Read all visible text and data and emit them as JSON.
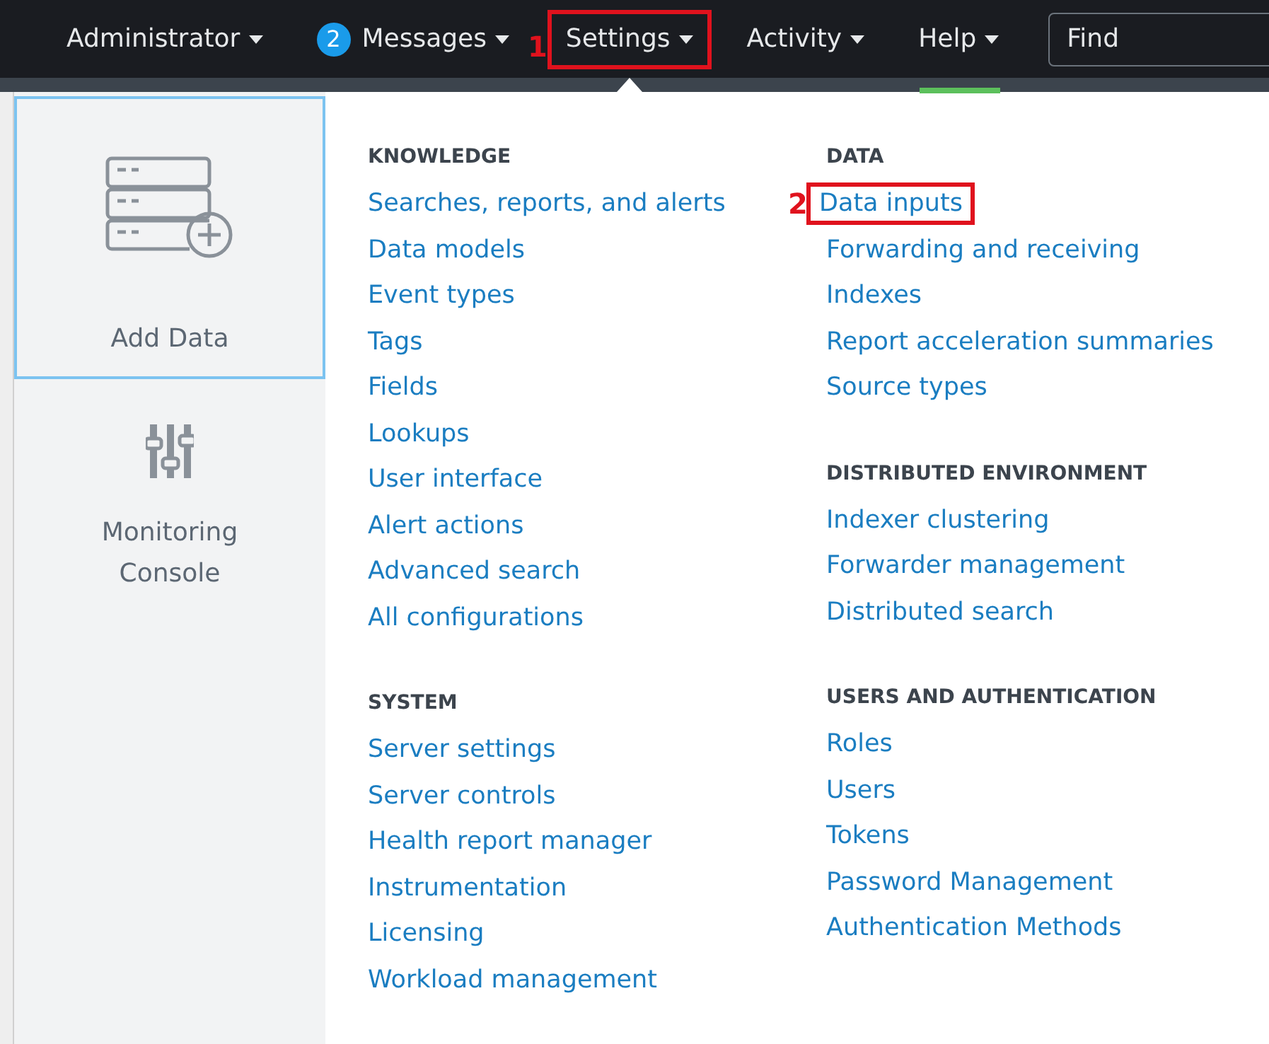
{
  "nav": [
    {
      "label": "Administrator",
      "highlighted": false,
      "open": false,
      "active": false
    },
    {
      "label": "Messages",
      "badge": "2",
      "highlighted": false,
      "open": false,
      "active": false
    },
    {
      "label": "Settings",
      "highlighted": true,
      "annotation": "1",
      "open": true,
      "active": false
    },
    {
      "label": "Activity",
      "highlighted": false,
      "open": false,
      "active": false
    },
    {
      "label": "Help",
      "highlighted": false,
      "open": false,
      "active": true
    }
  ],
  "search": {
    "placeholder": "Find"
  },
  "shortcuts": [
    {
      "label": "Add Data",
      "kind": "add-data",
      "selected": true
    },
    {
      "label": "Monitoring Console",
      "kind": "monitoring",
      "selected": false
    }
  ],
  "columns": [
    [
      {
        "title": "KNOWLEDGE",
        "items": [
          {
            "label": "Searches, reports, and alerts",
            "highlighted": false
          },
          {
            "label": "Data models",
            "highlighted": false
          },
          {
            "label": "Event types",
            "highlighted": false
          },
          {
            "label": "Tags",
            "highlighted": false
          },
          {
            "label": "Fields",
            "highlighted": false
          },
          {
            "label": "Lookups",
            "highlighted": false
          },
          {
            "label": "User interface",
            "highlighted": false
          },
          {
            "label": "Alert actions",
            "highlighted": false
          },
          {
            "label": "Advanced search",
            "highlighted": false
          },
          {
            "label": "All configurations",
            "highlighted": false
          }
        ]
      },
      {
        "title": "SYSTEM",
        "items": [
          {
            "label": "Server settings",
            "highlighted": false
          },
          {
            "label": "Server controls",
            "highlighted": false
          },
          {
            "label": "Health report manager",
            "highlighted": false
          },
          {
            "label": "Instrumentation",
            "highlighted": false
          },
          {
            "label": "Licensing",
            "highlighted": false
          },
          {
            "label": "Workload management",
            "highlighted": false
          }
        ]
      }
    ],
    [
      {
        "title": "DATA",
        "items": [
          {
            "label": "Data inputs",
            "highlighted": true,
            "annotation": "2"
          },
          {
            "label": "Forwarding and receiving",
            "highlighted": false
          },
          {
            "label": "Indexes",
            "highlighted": false
          },
          {
            "label": "Report acceleration summaries",
            "highlighted": false
          },
          {
            "label": "Source types",
            "highlighted": false
          }
        ]
      },
      {
        "title": "DISTRIBUTED ENVIRONMENT",
        "items": [
          {
            "label": "Indexer clustering",
            "highlighted": false
          },
          {
            "label": "Forwarder management",
            "highlighted": false
          },
          {
            "label": "Distributed search",
            "highlighted": false
          }
        ]
      },
      {
        "title": "USERS AND AUTHENTICATION",
        "items": [
          {
            "label": "Roles",
            "highlighted": false
          },
          {
            "label": "Users",
            "highlighted": false
          },
          {
            "label": "Tokens",
            "highlighted": false
          },
          {
            "label": "Password Management",
            "highlighted": false
          },
          {
            "label": "Authentication Methods",
            "highlighted": false
          }
        ]
      }
    ]
  ]
}
